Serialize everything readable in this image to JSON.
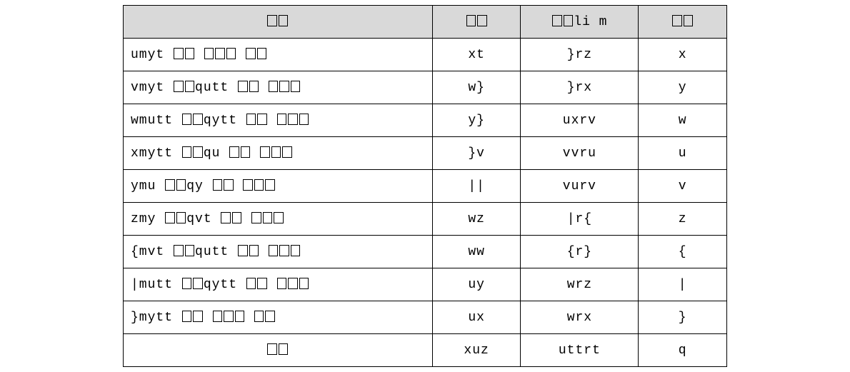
{
  "headers": [
    "□□",
    "□□",
    "□□li m",
    "□□"
  ],
  "rows": [
    [
      "umyt □□ □□□ □□",
      "xt",
      "}rz",
      "x"
    ],
    [
      "vmyt □□qutt □□ □□□",
      "w}",
      "}rx",
      "y"
    ],
    [
      "wmutt □□qytt □□ □□□",
      "y}",
      "uxrv",
      "w"
    ],
    [
      "xmytt □□qu □□ □□□",
      "}v",
      "vvru",
      "u"
    ],
    [
      "ymu □□qy □□ □□□",
      "||",
      "vurv",
      "v"
    ],
    [
      "zmy □□qvt □□ □□□",
      "wz",
      "|r{",
      "z"
    ],
    [
      "{mvt □□qutt □□ □□□",
      "ww",
      "{r}",
      "{"
    ],
    [
      "|mutt □□qytt □□ □□□",
      "uy",
      "wrz",
      "|"
    ],
    [
      "}mytt □□ □□□ □□",
      "ux",
      "wrx",
      "}"
    ],
    [
      "□□",
      "xuz",
      "uttrt",
      "q"
    ]
  ]
}
